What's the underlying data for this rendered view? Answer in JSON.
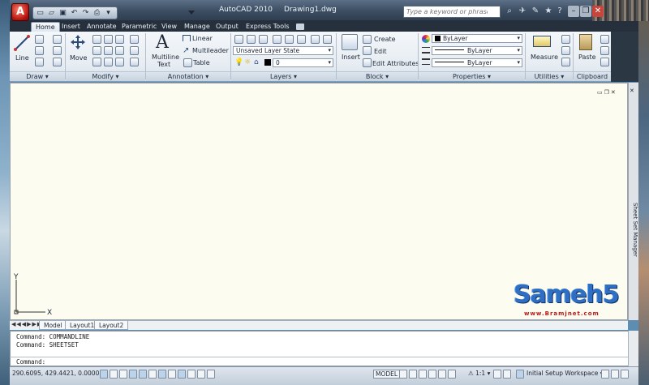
{
  "window": {
    "app_name": "AutoCAD 2010",
    "file_name": "Drawing1.dwg"
  },
  "search": {
    "placeholder": "Type a keyword or phrase"
  },
  "tabs": [
    {
      "label": "Home",
      "active": true
    },
    {
      "label": "Insert"
    },
    {
      "label": "Annotate"
    },
    {
      "label": "Parametric"
    },
    {
      "label": "View"
    },
    {
      "label": "Manage"
    },
    {
      "label": "Output"
    },
    {
      "label": "Express Tools"
    }
  ],
  "panels": {
    "draw": {
      "title": "Draw",
      "line_label": "Line"
    },
    "modify": {
      "title": "Modify",
      "move_label": "Move"
    },
    "annotation": {
      "title": "Annotation",
      "mtext_line1": "Multiline",
      "mtext_line2": "Text",
      "linear_label": "Linear",
      "multileader_label": "Multileader",
      "table_label": "Table"
    },
    "layers": {
      "title": "Layers",
      "layer_state": "Unsaved Layer State",
      "current_layer": "0"
    },
    "block": {
      "title": "Block",
      "insert_label": "Insert",
      "create_label": "Create",
      "edit_label": "Edit",
      "edit_attributes_label": "Edit Attributes"
    },
    "properties": {
      "title": "Properties",
      "color": "ByLayer",
      "linetype": "ByLayer",
      "lineweight": "ByLayer"
    },
    "utilities": {
      "title": "Utilities",
      "measure_label": "Measure"
    },
    "clipboard": {
      "title": "Clipboard",
      "paste_label": "Paste"
    }
  },
  "drawing": {
    "y_axis": "Y",
    "x_axis": "X",
    "sheetset_manager": "Sheet Set Manager"
  },
  "layout_tabs": [
    "Model",
    "Layout1",
    "Layout2"
  ],
  "command": {
    "history": [
      "Command: COMMANDLINE",
      "Command: SHEETSET"
    ],
    "prompt": "Command:"
  },
  "status": {
    "coordinates": "290.6095, 429.4421, 0.0000",
    "model_label": "MODEL",
    "scale": "1:1",
    "workspace": "Initial Setup Workspace"
  },
  "watermark": {
    "brand": "Sameh5",
    "url": "www.Bramjnet.com"
  },
  "colors": {
    "titlebar": "#3c4d62",
    "ribbon": "#e6ecf2",
    "drawing_bg": "#fdfcf1",
    "app_button": "#b8140e"
  }
}
